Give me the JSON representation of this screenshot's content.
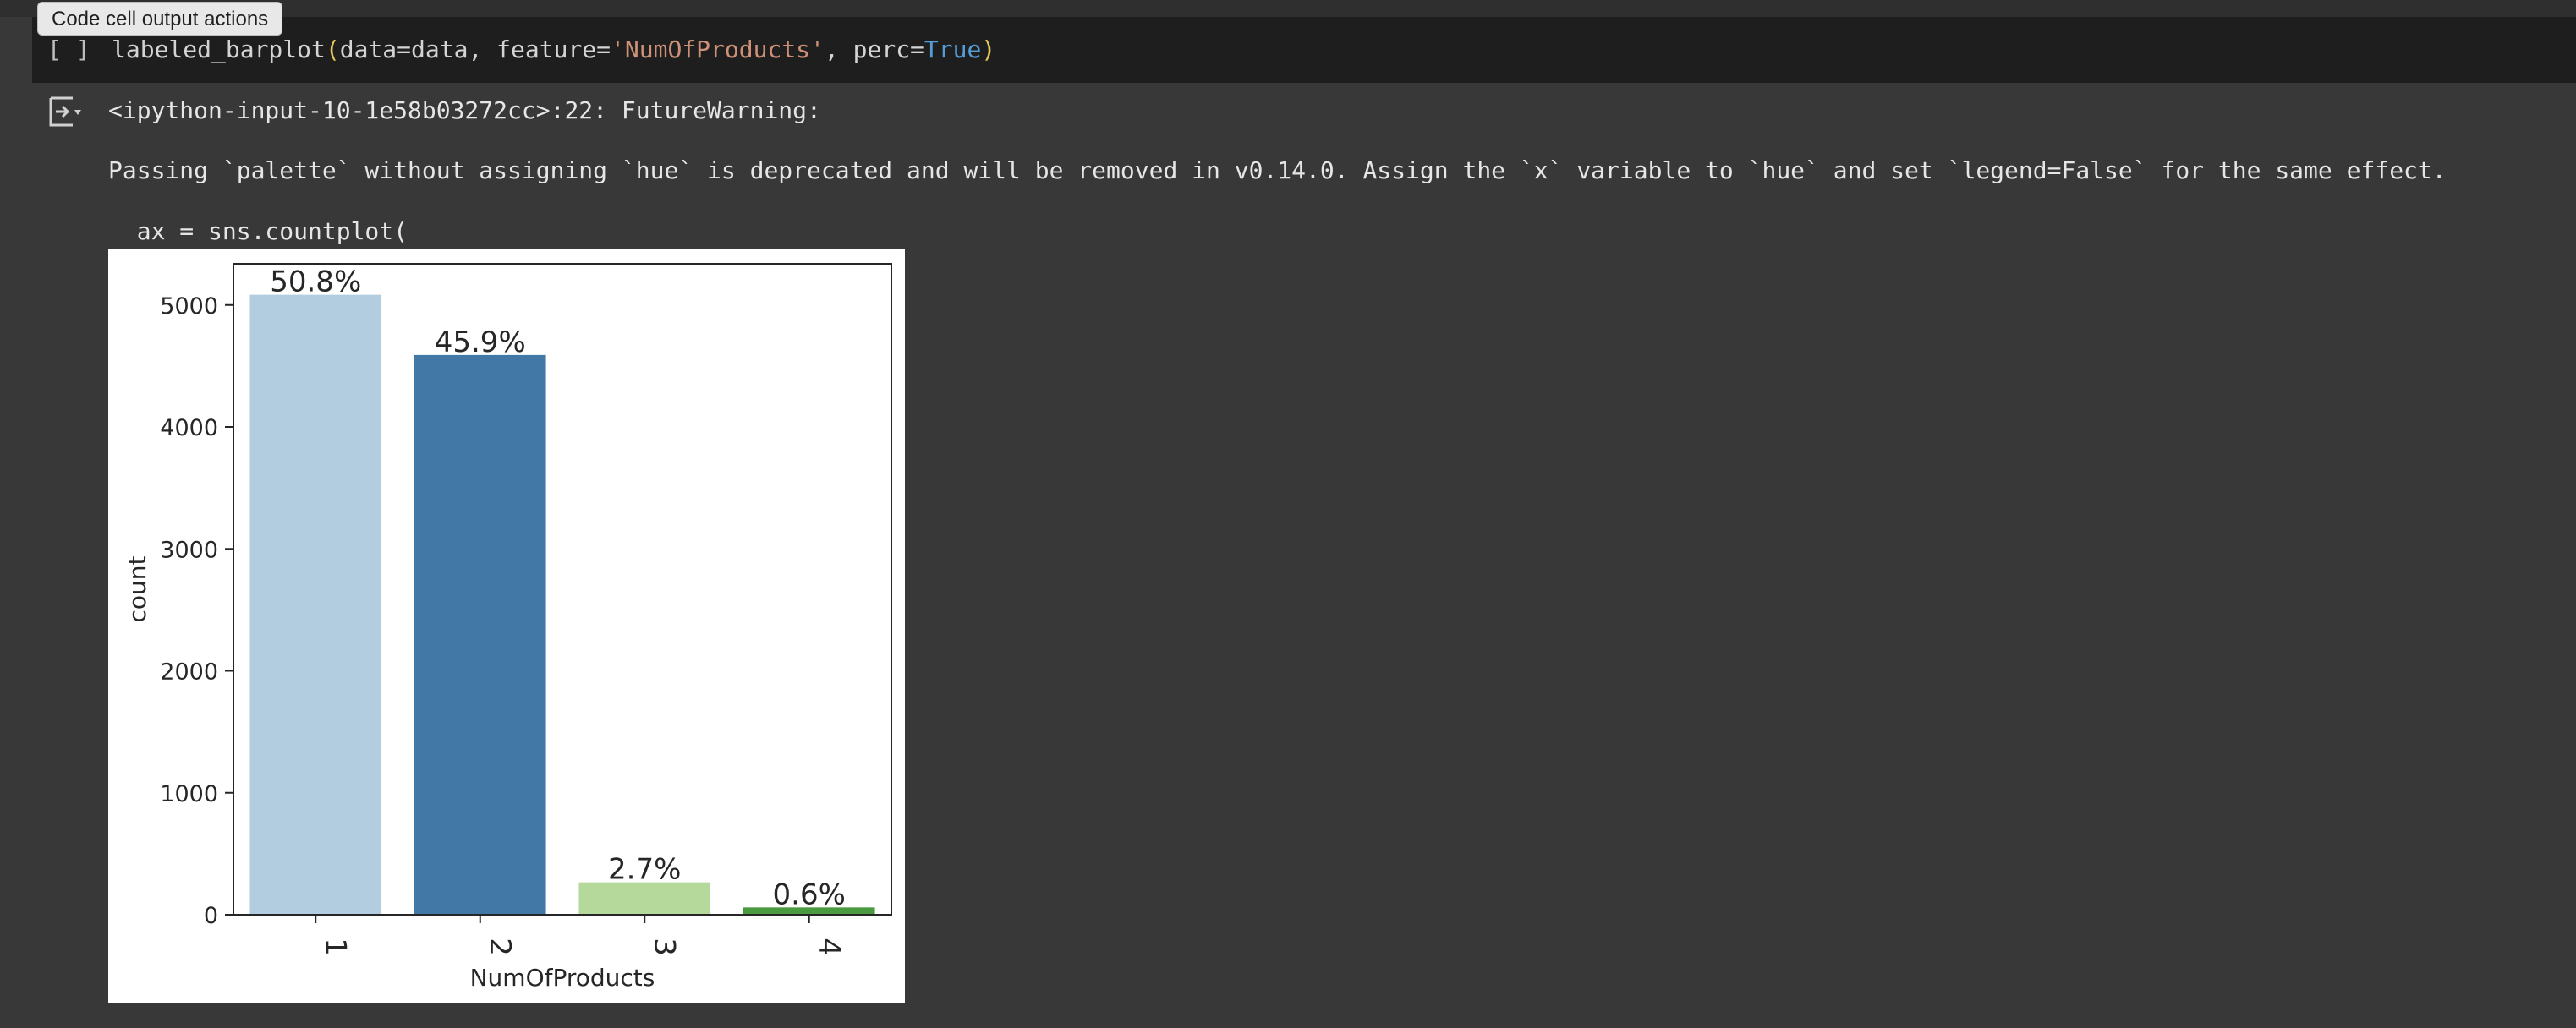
{
  "tooltip": {
    "label": "Code cell output actions"
  },
  "cell": {
    "run_bracket": "[ ]",
    "code": {
      "fn": "labeled_barplot",
      "open": "(",
      "arg1": "data=data, feature=",
      "str": "'NumOfProducts'",
      "arg2": ", perc=",
      "kw": "True",
      "close": ")"
    }
  },
  "output": {
    "warn_header": "<ipython-input-10-1e58b03272cc>:22: FutureWarning:",
    "warn_message": "Passing `palette` without assigning `hue` is deprecated and will be removed in v0.14.0. Assign the `x` variable to `hue` and set `legend=False` for the same effect.",
    "warn_code": "  ax = sns.countplot("
  },
  "chart_data": {
    "type": "bar",
    "categories": [
      "1",
      "2",
      "3",
      "4"
    ],
    "values": [
      5084,
      4590,
      266,
      60
    ],
    "data_labels": [
      "50.8%",
      "45.9%",
      "2.7%",
      "0.6%"
    ],
    "colors": [
      "#b3cde0",
      "#4178a6",
      "#b4d99a",
      "#4a9a3f"
    ],
    "xlabel": "NumOfProducts",
    "ylabel": "count",
    "ylim": [
      0,
      5338
    ],
    "yticks": [
      0,
      1000,
      2000,
      3000,
      4000,
      5000
    ],
    "grid": false
  }
}
